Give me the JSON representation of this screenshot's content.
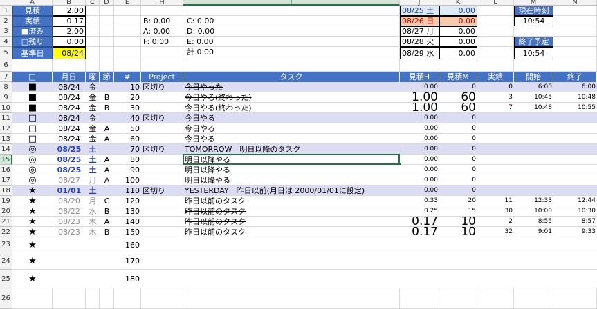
{
  "columns": [
    {
      "letter": "A"
    },
    {
      "letter": "B"
    },
    {
      "letter": "C"
    },
    {
      "letter": "D"
    },
    {
      "letter": "E"
    },
    {
      "letter": "H"
    },
    {
      "letter": "I",
      "selected": true
    },
    {
      "letter": "J"
    },
    {
      "letter": "K"
    },
    {
      "letter": "L"
    },
    {
      "letter": "M"
    },
    {
      "letter": "N"
    }
  ],
  "row_numbers": [
    "1",
    "2",
    "3",
    "4",
    "5",
    "6",
    "7",
    "8",
    "9",
    "10",
    "11",
    "12",
    "13",
    "14",
    "15",
    "16",
    "17",
    "18",
    "19",
    "20",
    "21",
    "22",
    "23",
    "24",
    "25",
    "26"
  ],
  "active_row": "15",
  "summary": {
    "rows": [
      {
        "label": "見積",
        "value": "2.00"
      },
      {
        "label": "実績",
        "value": "0.17"
      },
      {
        "label": "■済み",
        "value": "2.00"
      },
      {
        "label": "□残り",
        "value": "0.00"
      },
      {
        "label": "基準日",
        "value": "08/24"
      }
    ]
  },
  "stats": {
    "b": "B: 0.00",
    "c": "C: 0.00",
    "a": "A: 0.00",
    "d": "D: 0.00",
    "f": "F: 0.00",
    "e": "E: 0.00",
    "total": "計 0.00"
  },
  "calendar": [
    {
      "date": "08/25 土",
      "value": "0.00",
      "style": "sat"
    },
    {
      "date": "08/26 日",
      "value": "0.00",
      "style": "sun"
    },
    {
      "date": "08/27 月",
      "value": "0.00",
      "style": "normal"
    },
    {
      "date": "08/28 火",
      "value": "0.00",
      "style": "normal"
    },
    {
      "date": "08/29 水",
      "value": "0.00",
      "style": "normal"
    }
  ],
  "clock": {
    "now_label": "現在時刻",
    "now_value": "10:54",
    "end_label": "終了予定",
    "end_value": "10:54"
  },
  "table_headers": [
    "□",
    "月日",
    "曜",
    "節",
    "#",
    "Project",
    "タスク",
    "見積H",
    "見積M",
    "実績",
    "開始",
    "終了"
  ],
  "rows": [
    {
      "mark": "■",
      "date": "08/24",
      "dow": "金",
      "sec": "",
      "num": "10",
      "project": "区切り",
      "task": "今日やった",
      "h": "0.00",
      "m": "0",
      "act": "0",
      "start": "6:00",
      "end": "6:00",
      "style": "band",
      "strike": true
    },
    {
      "mark": "■",
      "date": "08/24",
      "dow": "金",
      "sec": "B",
      "num": "20",
      "project": "",
      "task": "今日やる(終わった)",
      "h": "1.00",
      "m": "60",
      "act": "3",
      "start": "10:45",
      "end": "10:48",
      "style": "normal",
      "strike": true,
      "big": true
    },
    {
      "mark": "■",
      "date": "08/24",
      "dow": "金",
      "sec": "B",
      "num": "30",
      "project": "",
      "task": "今日やる(終わった)",
      "h": "1.00",
      "m": "60",
      "act": "7",
      "start": "10:48",
      "end": "10:55",
      "style": "normal",
      "strike": true,
      "big": true
    },
    {
      "mark": "□",
      "date": "08/24",
      "dow": "金",
      "sec": "",
      "num": "40",
      "project": "区切り",
      "task": "今日やる",
      "h": "0.00",
      "m": "0",
      "act": "",
      "start": "",
      "end": "",
      "style": "band"
    },
    {
      "mark": "□",
      "date": "08/24",
      "dow": "金",
      "sec": "A",
      "num": "50",
      "project": "",
      "task": "今日やる",
      "h": "0.00",
      "m": "0",
      "act": "",
      "start": "",
      "end": "",
      "style": "normal"
    },
    {
      "mark": "□",
      "date": "08/24",
      "dow": "金",
      "sec": "A",
      "num": "60",
      "project": "",
      "task": "今日やる",
      "h": "0.00",
      "m": "0",
      "act": "",
      "start": "",
      "end": "",
      "style": "normal"
    },
    {
      "mark": "◎",
      "date": "08/25",
      "dow": "土",
      "sec": "",
      "num": "70",
      "project": "区切り",
      "task": "TOMORROW　明日以降のタスク",
      "h": "0.00",
      "m": "0",
      "act": "",
      "start": "",
      "end": "",
      "style": "band",
      "datecolor": "blue"
    },
    {
      "mark": "◎",
      "date": "08/25",
      "dow": "土",
      "sec": "A",
      "num": "80",
      "project": "",
      "task": "明日以降やる",
      "h": "0.00",
      "m": "0",
      "act": "",
      "start": "",
      "end": "",
      "style": "normal",
      "datecolor": "blue",
      "selected": true
    },
    {
      "mark": "◎",
      "date": "08/25",
      "dow": "土",
      "sec": "A",
      "num": "90",
      "project": "",
      "task": "明日以降やる",
      "h": "0.00",
      "m": "0",
      "act": "",
      "start": "",
      "end": "",
      "style": "normal",
      "datecolor": "blue"
    },
    {
      "mark": "◎",
      "date": "08/27",
      "dow": "月",
      "sec": "A",
      "num": "100",
      "project": "",
      "task": "明日以降やる",
      "h": "0.00",
      "m": "0",
      "act": "",
      "start": "",
      "end": "",
      "style": "normal",
      "datecolor": "gray"
    },
    {
      "mark": "★",
      "date": "01/01",
      "dow": "土",
      "sec": "",
      "num": "110",
      "project": "区切り",
      "task": "YESTERDAY　昨日以前(月日は 2000/01/01に設定)",
      "h": "0.00",
      "m": "0",
      "act": "",
      "start": "",
      "end": "",
      "style": "band",
      "datecolor": "blue"
    },
    {
      "mark": "★",
      "date": "08/20",
      "dow": "月",
      "sec": "C",
      "num": "120",
      "project": "",
      "task": "昨日以前のタスク",
      "h": "0.33",
      "m": "20",
      "act": "11",
      "start": "12:33",
      "end": "12:44",
      "style": "normal",
      "datecolor": "gray",
      "strike": true
    },
    {
      "mark": "★",
      "date": "08/22",
      "dow": "水",
      "sec": "B",
      "num": "130",
      "project": "",
      "task": "昨日以前のタスク",
      "h": "0.25",
      "m": "15",
      "act": "30",
      "start": "10:00",
      "end": "10:30",
      "style": "normal",
      "datecolor": "gray",
      "strike": true
    },
    {
      "mark": "★",
      "date": "08/23",
      "dow": "木",
      "sec": "A",
      "num": "140",
      "project": "",
      "task": "昨日以前のタスク",
      "h": "0.17",
      "m": "10",
      "act": "2",
      "start": "8:55",
      "end": "8:57",
      "style": "normal",
      "datecolor": "gray",
      "strike": true,
      "big": true
    },
    {
      "mark": "★",
      "date": "08/23",
      "dow": "木",
      "sec": "B",
      "num": "150",
      "project": "",
      "task": "昨日以前のタスク",
      "h": "0.17",
      "m": "10",
      "act": "32",
      "start": "9:01",
      "end": "9:33",
      "style": "normal",
      "datecolor": "gray",
      "strike": true,
      "big": true
    },
    {
      "mark": "★",
      "date": "",
      "dow": "",
      "sec": "",
      "num": "160",
      "project": "",
      "task": "",
      "h": "",
      "m": "",
      "act": "",
      "start": "",
      "end": "",
      "style": "normal"
    },
    {
      "mark": "★",
      "date": "",
      "dow": "",
      "sec": "",
      "num": "170",
      "project": "",
      "task": "",
      "h": "",
      "m": "",
      "act": "",
      "start": "",
      "end": "",
      "style": "normal"
    },
    {
      "mark": "★",
      "date": "",
      "dow": "",
      "sec": "",
      "num": "180",
      "project": "",
      "task": "",
      "h": "",
      "m": "",
      "act": "",
      "start": "",
      "end": "",
      "style": "normal"
    }
  ],
  "colors": {
    "header_blue": "#4472c4",
    "band": "#dcdcf2",
    "sat": "#ddebf7",
    "sun": "#f8cbad",
    "highlight_yellow": "#ffff00",
    "date_blue": "#1f3fbf",
    "date_gray": "#8c8c8c",
    "accent_green": "#217346"
  }
}
